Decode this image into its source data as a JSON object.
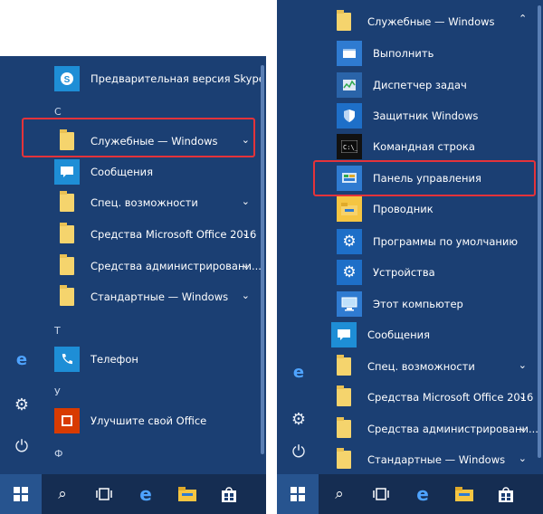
{
  "left": {
    "items": [
      {
        "label": "Предварительная версия Skype",
        "icon": "skype-icon",
        "color": "#1e8ed6"
      },
      {
        "label": "Служебные — Windows",
        "icon": "folder-icon",
        "chevron": true
      },
      {
        "label": "Сообщения",
        "icon": "message-icon",
        "color": "#1e8ed6"
      },
      {
        "label": "Спец. возможности",
        "icon": "folder-icon",
        "chevron": true
      },
      {
        "label": "Средства Microsoft Office 2016",
        "icon": "folder-icon",
        "chevron": true
      },
      {
        "label": "Средства администрировани...",
        "icon": "folder-icon",
        "chevron": true
      },
      {
        "label": "Стандартные — Windows",
        "icon": "folder-icon",
        "chevron": true
      },
      {
        "label": "Телефон",
        "icon": "phone-icon",
        "color": "#1e8ed6"
      },
      {
        "label": "Улучшите свой Office",
        "icon": "office-icon",
        "color": "#d83b01"
      }
    ],
    "headers": {
      "s": "С",
      "t": "Т",
      "u": "У",
      "f": "Ф"
    }
  },
  "right": {
    "items": [
      {
        "label": "Служебные — Windows",
        "icon": "folder-icon",
        "chevron": true
      },
      {
        "label": "Выполнить",
        "icon": "run-icon",
        "color": "#2f7bd1"
      },
      {
        "label": "Диспетчер задач",
        "icon": "task-manager-icon",
        "color": "#2a64a9"
      },
      {
        "label": "Защитник Windows",
        "icon": "shield-icon",
        "color": "#1e6fc8"
      },
      {
        "label": "Командная строка",
        "icon": "cmd-icon",
        "color": "#111111"
      },
      {
        "label": "Панель управления",
        "icon": "control-panel-icon",
        "color": "#2f7bd1"
      },
      {
        "label": "Проводник",
        "icon": "explorer-icon",
        "color": "#f5c542"
      },
      {
        "label": "Программы по умолчанию",
        "icon": "gear-icon",
        "color": "#1e6fc8"
      },
      {
        "label": "Устройства",
        "icon": "gear-icon",
        "color": "#1e6fc8"
      },
      {
        "label": "Этот компьютер",
        "icon": "computer-icon",
        "color": "#2f7bd1"
      },
      {
        "label": "Сообщения",
        "icon": "message-icon",
        "color": "#1e8ed6"
      },
      {
        "label": "Спец. возможности",
        "icon": "folder-icon",
        "chevron": true
      },
      {
        "label": "Средства Microsoft Office 2016",
        "icon": "folder-icon",
        "chevron": true
      },
      {
        "label": "Средства администрировани...",
        "icon": "folder-icon",
        "chevron": true
      },
      {
        "label": "Стандартные — Windows",
        "icon": "folder-icon",
        "chevron": true
      }
    ]
  },
  "glyphs": {
    "edge": "e",
    "gear": "⚙",
    "power": "⏻",
    "search": "⌕",
    "chevron": "⌄"
  },
  "colors": {
    "accent": "#1e6fc8",
    "highlight": "#e4333a"
  }
}
